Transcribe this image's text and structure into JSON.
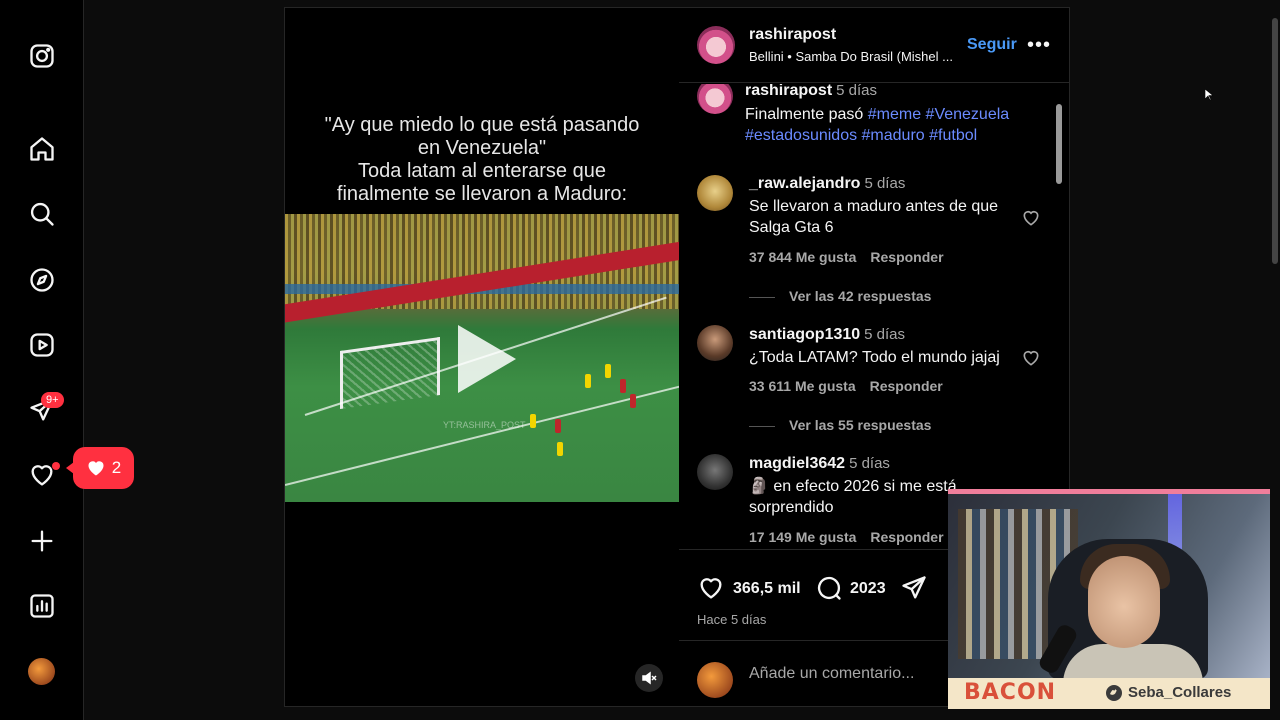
{
  "sidebar": {
    "icons": [
      "instagram-logo-icon",
      "home-icon",
      "search-icon",
      "explore-compass-icon",
      "reels-icon",
      "messages-icon",
      "notifications-heart-icon",
      "create-plus-icon",
      "dashboard-icon",
      "profile-avatar"
    ],
    "messages_badge": "9+",
    "notification_popup_count": "2"
  },
  "video": {
    "caption_lines": [
      "\"Ay que miedo lo que está pasando",
      "en Venezuela\"",
      "Toda latam al enterarse que",
      "finalmente se llevaron a Maduro:"
    ],
    "watermark": "YT:RASHIRA_POST"
  },
  "header": {
    "username": "rashirapost",
    "audio": "Bellini • Samba Do Brasil (Mishel ...",
    "follow_label": "Seguir",
    "more_label": "•••"
  },
  "caption": {
    "username": "rashirapost",
    "time": "5 días",
    "text": "Finalmente pasó",
    "tags_line1": "#meme #Venezuela",
    "tags_line2": "#estadosunidos #maduro #futbol"
  },
  "comments": [
    {
      "user": "_raw.alejandro",
      "time": "5 días",
      "text": "Se llevaron a maduro antes de que Salga Gta 6",
      "likes": "37 844 Me gusta",
      "reply": "Responder",
      "view_replies": "Ver las 42 respuestas"
    },
    {
      "user": "santiagop1310",
      "time": "5 días",
      "text": "¿Toda LATAM? Todo el mundo jajaj",
      "likes": "33 611 Me gusta",
      "reply": "Responder",
      "view_replies": "Ver las 55 respuestas"
    },
    {
      "user": "magdiel3642",
      "time": "5 días",
      "text": "🗿 en efecto 2026 si me está sorprendido",
      "likes": "17 149 Me gusta",
      "reply": "Responder"
    }
  ],
  "actions": {
    "likes": "366,5 mil",
    "comments": "2023",
    "time_ago": "Hace 5 días"
  },
  "add_comment": {
    "placeholder": "Añade un comentario..."
  },
  "webcam": {
    "brand": "BACON",
    "handle": "Seba_Collares"
  },
  "colors": {
    "link": "#4a99f6",
    "hashtag": "#6b8bff",
    "badge": "#ff3040",
    "webcam_border": "#f07e9b"
  }
}
